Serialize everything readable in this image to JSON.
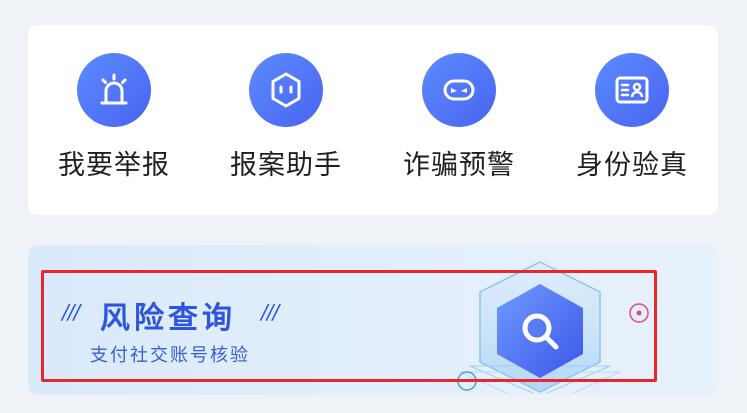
{
  "services": [
    {
      "label": "我要举报",
      "icon": "alarm-icon"
    },
    {
      "label": "报案助手",
      "icon": "robot-assistant-icon"
    },
    {
      "label": "诈骗预警",
      "icon": "mask-icon"
    },
    {
      "label": "身份验真",
      "icon": "id-card-icon"
    }
  ],
  "banner": {
    "title": "风险查询",
    "subtitle": "支付社交账号核验",
    "slash_left": "///",
    "slash_right": "///",
    "icon": "search-icon"
  },
  "colors": {
    "accent": "#2f55e0",
    "icon_bg": "#4f6ff0",
    "highlight": "#e8262e",
    "page_bg": "#eff2f7"
  }
}
